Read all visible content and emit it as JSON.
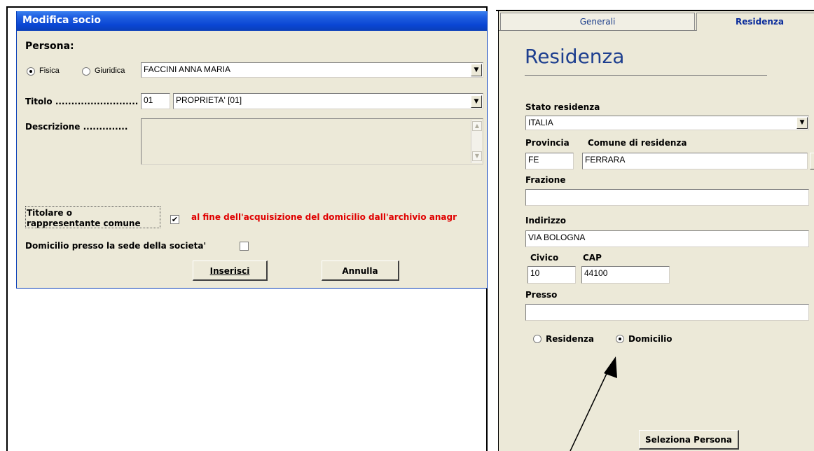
{
  "dialog": {
    "title": "Modifica socio",
    "persona_label": "Persona:",
    "radio_fisica": "Fisica",
    "radio_giuridica": "Giuridica",
    "persona_value": "FACCINI ANNA MARIA",
    "titolo_label": "Titolo ..........................",
    "titolo_code": "01",
    "titolo_value": "PROPRIETA' [01]",
    "descrizione_label": "Descrizione ..............",
    "titolare_label_1": "Titolare o",
    "titolare_label_2": "rappresentante comune",
    "titolare_checked": true,
    "titolare_note": "al fine dell'acquisizione del domicilio dall'archivio anagr",
    "domicilio_label": "Domicilio presso la sede della societa'",
    "domicilio_checked": false,
    "btn_inserisci": "Inserisci",
    "btn_annulla": "Annulla"
  },
  "panel": {
    "tabs": [
      "Generali",
      "Residenza"
    ],
    "heading": "Residenza",
    "stato_label": "Stato residenza",
    "stato_value": "ITALIA",
    "provincia_label": "Provincia",
    "provincia_value": "FE",
    "comune_label": "Comune di residenza",
    "comune_value": "FERRARA",
    "frazione_label": "Frazione",
    "frazione_value": "",
    "indirizzo_label": "Indirizzo",
    "indirizzo_value": "VIA BOLOGNA",
    "civico_label": "Civico",
    "civico_value": "10",
    "cap_label": "CAP",
    "cap_value": "44100",
    "presso_label": "Presso",
    "presso_value": "",
    "radio_residenza": "Residenza",
    "radio_domicilio": "Domicilio",
    "selected_radio": "Domicilio",
    "btn_seleziona": "Seleziona Persona"
  },
  "colors": {
    "titlebar": "#0a46d4",
    "dialog_bg": "#ece9d8",
    "note_red": "#e00000",
    "heading_blue": "#1e3f8f"
  },
  "icons": [
    "chevron-down-icon",
    "arrow-up-icon",
    "arrow-down-icon",
    "checkmark-icon",
    "annotation-arrow"
  ]
}
